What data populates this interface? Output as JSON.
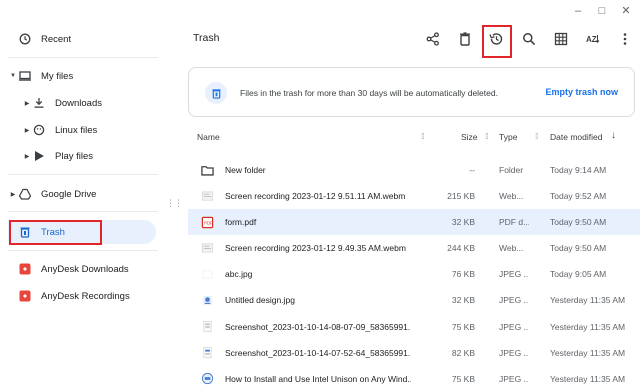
{
  "window": {
    "minimize": "–",
    "maximize": "□",
    "close": "✕"
  },
  "sidebar": {
    "recent": "Recent",
    "my_files": "My files",
    "downloads": "Downloads",
    "linux_files": "Linux files",
    "play_files": "Play files",
    "google_drive": "Google Drive",
    "trash": "Trash",
    "anydesk_downloads": "AnyDesk Downloads",
    "anydesk_recordings": "AnyDesk Recordings"
  },
  "toolbar": {
    "title": "Trash"
  },
  "banner": {
    "message": "Files in the trash for more than 30 days will be automatically deleted.",
    "action": "Empty trash now"
  },
  "table": {
    "headers": {
      "name": "Name",
      "size": "Size",
      "type": "Type",
      "date": "Date modified"
    },
    "rows": [
      {
        "name": "New folder",
        "size": "--",
        "type": "Folder",
        "date": "Today 9:14 AM",
        "icon": "folder-icon"
      },
      {
        "name": "Screen recording 2023-01-12 9.51.11 AM.webm",
        "size": "215 KB",
        "type": "Web...",
        "date": "Today 9:52 AM",
        "icon": "video-thumbnail-icon"
      },
      {
        "name": "form.pdf",
        "size": "32 KB",
        "type": "PDF d...",
        "date": "Today 9:50 AM",
        "icon": "pdf-icon"
      },
      {
        "name": "Screen recording 2023-01-12 9.49.35 AM.webm",
        "size": "244 KB",
        "type": "Web...",
        "date": "Today 9:50 AM",
        "icon": "video-thumbnail-icon"
      },
      {
        "name": "abc.jpg",
        "size": "76 KB",
        "type": "JPEG ...",
        "date": "Today 9:05 AM",
        "icon": "image-thumbnail-icon"
      },
      {
        "name": "Untitled design.jpg",
        "size": "32 KB",
        "type": "JPEG ...",
        "date": "Yesterday 11:35 AM",
        "icon": "image-thumbnail-icon"
      },
      {
        "name": "Screenshot_2023-01-10-14-08-07-09_58365991...",
        "size": "75 KB",
        "type": "JPEG ...",
        "date": "Yesterday 11:35 AM",
        "icon": "image-thumbnail-icon"
      },
      {
        "name": "Screenshot_2023-01-10-14-07-52-64_58365991...",
        "size": "82 KB",
        "type": "JPEG ...",
        "date": "Yesterday 11:35 AM",
        "icon": "image-thumbnail-icon"
      },
      {
        "name": "How to Install and Use Intel Unison on Any Wind...",
        "size": "75 KB",
        "type": "JPEG ...",
        "date": "Yesterday 11:35 AM",
        "icon": "image-thumbnail-icon"
      }
    ]
  },
  "colors": {
    "accent": "#1a73e8",
    "selection": "#e8f0fe",
    "highlight": "#e0262b",
    "trash_icon": "#1a73e8"
  }
}
